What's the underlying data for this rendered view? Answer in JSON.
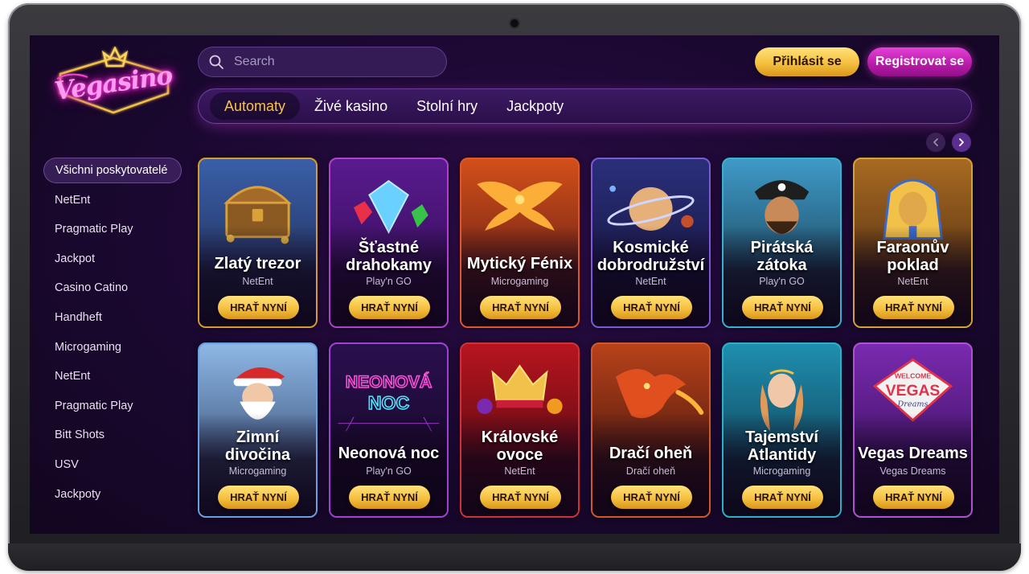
{
  "brand": {
    "logo_text": "Vegasino"
  },
  "search": {
    "placeholder": "Search"
  },
  "header": {
    "login_label": "Přihlásit se",
    "register_label": "Registrovat se"
  },
  "tabs": [
    {
      "label": "Automaty",
      "active": true
    },
    {
      "label": "Živé kasino",
      "active": false
    },
    {
      "label": "Stolní hry",
      "active": false
    },
    {
      "label": "Jackpoty",
      "active": false
    }
  ],
  "sidebar": {
    "items": [
      {
        "label": "Všichni poskytovatelé",
        "active": true
      },
      {
        "label": "NetEnt"
      },
      {
        "label": "Pragmatic Play"
      },
      {
        "label": "Jackpot"
      },
      {
        "label": "Casino Catino"
      },
      {
        "label": "Handheft"
      },
      {
        "label": "Microgaming"
      },
      {
        "label": "NetEnt"
      },
      {
        "label": "Pragmatic Play"
      },
      {
        "label": "Bitt Shots"
      },
      {
        "label": "USV"
      },
      {
        "label": "Jackpoty"
      }
    ]
  },
  "games": [
    {
      "title": "Zlatý trezor",
      "provider": "NetEnt",
      "play_label": "HRAŤ NYNÍ",
      "icon": "treasure-chest-icon",
      "bg_top": "#3a5fa8",
      "bg_bottom": "#1b2246",
      "border": "#d69a2e",
      "accent": "#d9a13a"
    },
    {
      "title": "Šťastné drahokamy",
      "provider": "Play'n GO",
      "play_label": "HRAŤ NYNÍ",
      "icon": "gems-icon",
      "bg_top": "#5a1a8f",
      "bg_bottom": "#2a0b4a",
      "border": "#b040d0",
      "accent": "#5fd0ff"
    },
    {
      "title": "Mytický Fénix",
      "provider": "Microgaming",
      "play_label": "HRAŤ NYNÍ",
      "icon": "phoenix-icon",
      "bg_top": "#d2501a",
      "bg_bottom": "#4a0f14",
      "border": "#e0552a",
      "accent": "#ffb43a"
    },
    {
      "title": "Kosmické dobrodružství",
      "provider": "NetEnt",
      "play_label": "HRAŤ NYNÍ",
      "icon": "planet-icon",
      "bg_top": "#2a2f7a",
      "bg_bottom": "#120f33",
      "border": "#7a5ad8",
      "accent": "#e6b07a"
    },
    {
      "title": "Pirátská zátoka",
      "provider": "Play'n GO",
      "play_label": "HRAŤ NYNÍ",
      "icon": "pirate-icon",
      "bg_top": "#3f9ac8",
      "bg_bottom": "#0f2a38",
      "border": "#3ab0d0",
      "accent": "#1e1e1e"
    },
    {
      "title": "Faraonův poklad",
      "provider": "NetEnt",
      "play_label": "HRAŤ NYNÍ",
      "icon": "pharaoh-icon",
      "bg_top": "#a86a22",
      "bg_bottom": "#3a1f0c",
      "border": "#d6a03a",
      "accent": "#f2c14a"
    },
    {
      "title": "Zimní divočina",
      "provider": "Microgaming",
      "play_label": "HRAŤ NYNÍ",
      "icon": "santa-icon",
      "bg_top": "#8fb8e6",
      "bg_bottom": "#1d2f55",
      "border": "#6aa0e0",
      "accent": "#d62a2a"
    },
    {
      "title": "Neonová noc",
      "provider": "Play'n GO",
      "play_label": "HRAŤ NYNÍ",
      "icon": "neon-sign-icon",
      "bg_top": "#2a0f4e",
      "bg_bottom": "#12061f",
      "border": "#a040d8",
      "accent": "#ff4fd8",
      "art_line1": "NEONOVÁ",
      "art_line2": "NOC"
    },
    {
      "title": "Královské ovoce",
      "provider": "NetEnt",
      "play_label": "HRAŤ NYNÍ",
      "icon": "crown-fruit-icon",
      "bg_top": "#b8151e",
      "bg_bottom": "#3a0610",
      "border": "#d0303a",
      "accent": "#f2c14a"
    },
    {
      "title": "Dračí oheň",
      "provider": "Dračí oheň",
      "play_label": "HRAŤ NYNÍ",
      "icon": "dragon-icon",
      "bg_top": "#b8421a",
      "bg_bottom": "#2a0a0a",
      "border": "#d0582a",
      "accent": "#e0501e"
    },
    {
      "title": "Tajemství Atlantidy",
      "provider": "Microgaming",
      "play_label": "HRAŤ NYNÍ",
      "icon": "mermaid-icon",
      "bg_top": "#1f8fb0",
      "bg_bottom": "#0a2a3c",
      "border": "#2ab0c8",
      "accent": "#e09a5a"
    },
    {
      "title": "Vegas Dreams",
      "provider": "Vegas Dreams",
      "play_label": "HRAŤ NYNÍ",
      "icon": "vegas-sign-icon",
      "bg_top": "#7a2ab0",
      "bg_bottom": "#2a0b4a",
      "border": "#b050d8",
      "accent": "#e0334a",
      "art_line1": "WELCOME",
      "art_line2": "VEGAS",
      "art_line3": "Dreams"
    }
  ]
}
